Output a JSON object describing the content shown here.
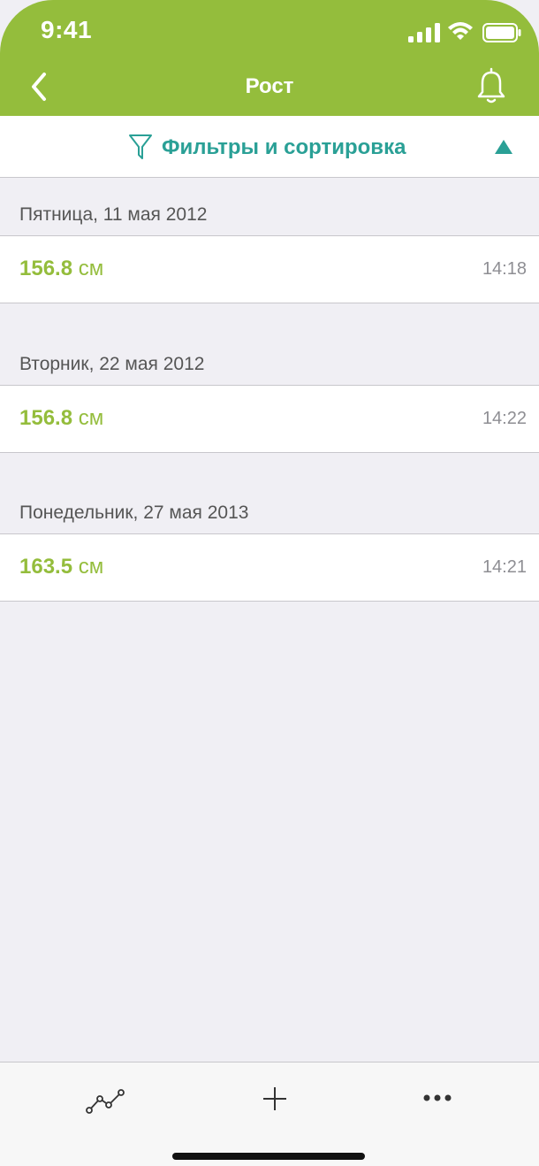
{
  "status_bar": {
    "time": "9:41"
  },
  "nav": {
    "title": "Рост"
  },
  "filter": {
    "label": "Фильтры и сортировка"
  },
  "sections": [
    {
      "date": "Пятница, 11 мая 2012",
      "value": "156.8",
      "unit": "см",
      "time": "14:18"
    },
    {
      "date": "Вторник, 22 мая 2012",
      "value": "156.8",
      "unit": "см",
      "time": "14:22"
    },
    {
      "date": "Понедельник, 27 мая 2013",
      "value": "163.5",
      "unit": "см",
      "time": "14:21"
    }
  ],
  "tabbar": {
    "items": [
      {
        "icon": "chart-line-icon"
      },
      {
        "icon": "plus-icon"
      },
      {
        "icon": "more-icon"
      }
    ]
  },
  "colors": {
    "header": "#94bd3c",
    "accent": "#2aa096",
    "value": "#94bd3c",
    "background": "#f0eff4"
  }
}
